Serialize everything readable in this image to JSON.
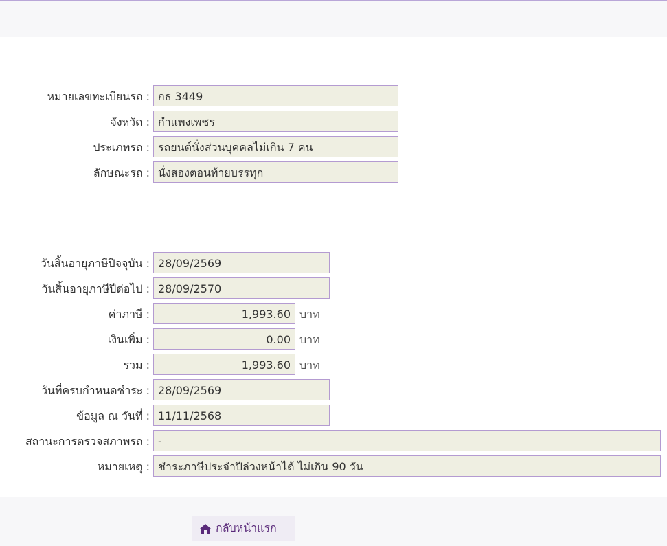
{
  "vehicle": {
    "plate_label": "หมายเลขทะเบียนรถ :",
    "plate_value": "กธ 3449",
    "province_label": "จังหวัด :",
    "province_value": "กำแพงเพชร",
    "type_label": "ประเภทรถ :",
    "type_value": "รถยนต์นั่งส่วนบุคคลไม่เกิน 7 คน",
    "style_label": "ลักษณะรถ :",
    "style_value": "นั่งสองตอนท้ายบรรทุก"
  },
  "tax": {
    "current_expiry_label": "วันสิ้นอายุภาษีปีจจุบัน :",
    "current_expiry_value": "28/09/2569",
    "next_expiry_label": "วันสิ้นอายุภาษีปีต่อไป :",
    "next_expiry_value": "28/09/2570",
    "fee_label": "ค่าภาษี :",
    "fee_value": "1,993.60",
    "surcharge_label": "เงินเพิ่ม :",
    "surcharge_value": "0.00",
    "total_label": "รวม :",
    "total_value": "1,993.60",
    "unit": "บาท",
    "due_date_label": "วันที่ครบกำหนดชำระ :",
    "due_date_value": "28/09/2569",
    "as_of_label": "ข้อมูล ณ วันที่ :",
    "as_of_value": "11/11/2568",
    "inspection_label": "สถานะการตรวจสภาพรถ :",
    "inspection_value": "-",
    "note_label": "หมายเหตุ :",
    "note_value": "ชำระภาษีประจำปีล่วงหน้าได้ ไม่เกิน 90 วัน"
  },
  "footer": {
    "home_button_label": "กลับหน้าแรก",
    "home_icon": "home-icon"
  },
  "colors": {
    "field_bg": "#efefe2",
    "field_border": "#b49bd1",
    "accent": "#5a2a7a"
  }
}
